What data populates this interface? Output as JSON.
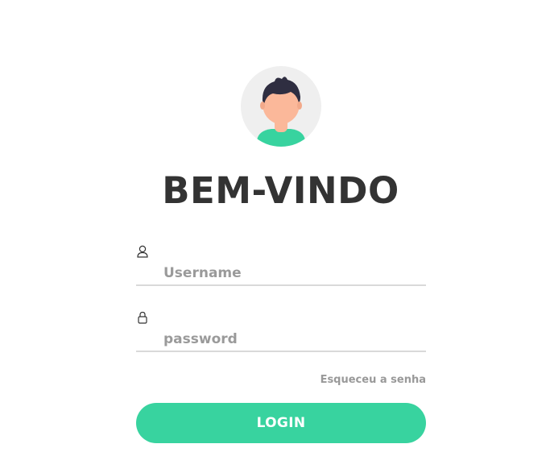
{
  "avatar": {
    "icon": "user-avatar-icon"
  },
  "heading": {
    "title": "BEM-VINDO"
  },
  "username": {
    "icon": "user-icon",
    "placeholder": "Username",
    "value": ""
  },
  "password": {
    "icon": "lock-icon",
    "placeholder": "password",
    "value": ""
  },
  "forgot": {
    "label": "Esqueceu a senha"
  },
  "login": {
    "label": "LOGIN"
  },
  "colors": {
    "accent": "#38d39f",
    "heading": "#333333",
    "muted": "#999999",
    "underline": "#d9d9d9",
    "avatar_bg": "#efefef",
    "skin": "#fbb89a",
    "hair": "#2f2e41",
    "shirt": "#38d39f"
  }
}
